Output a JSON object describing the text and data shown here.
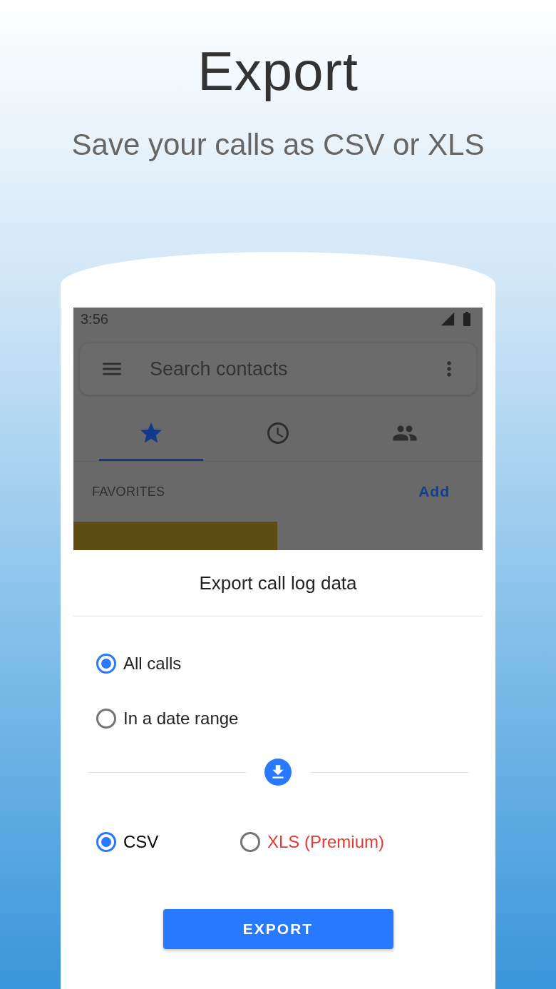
{
  "headline": {
    "title": "Export",
    "subtitle": "Save your calls as CSV or XLS"
  },
  "phone": {
    "status_bar": {
      "time": "3:56"
    },
    "search": {
      "placeholder": "Search contacts"
    },
    "tabs": [
      {
        "selected": true
      },
      {
        "selected": false
      },
      {
        "selected": false
      }
    ],
    "section": {
      "label": "FAVORITES",
      "action": "Add"
    },
    "dialog": {
      "title": "Export call log data",
      "range_options": [
        {
          "label": "All calls",
          "selected": true
        },
        {
          "label": "In a date range",
          "selected": false
        }
      ],
      "format_options": [
        {
          "label": "CSV",
          "selected": true,
          "color": "#000000"
        },
        {
          "label": "XLS (Premium)",
          "selected": false,
          "color": "#e53935"
        }
      ],
      "button": "EXPORT"
    }
  }
}
